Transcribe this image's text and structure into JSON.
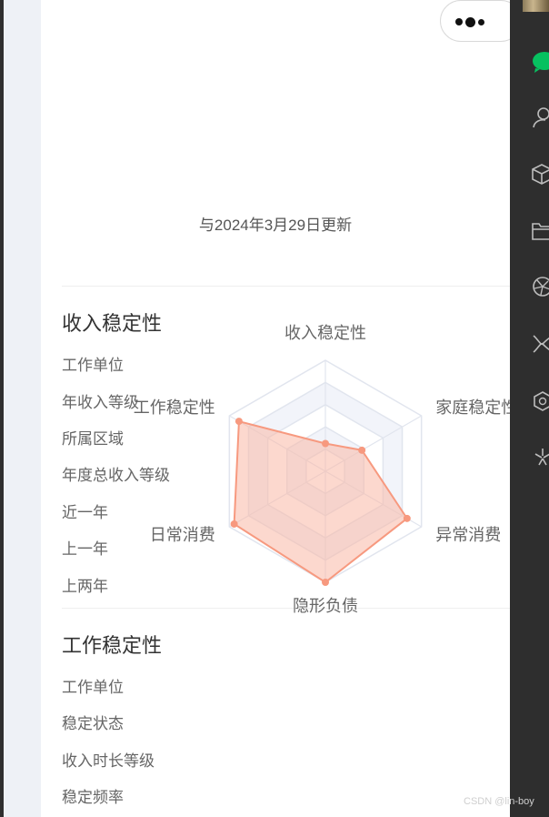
{
  "header": {
    "more_icon": "more-dots-icon",
    "update_text": "与2024年3月29日更新"
  },
  "income_section": {
    "title": "收入稳定性",
    "rows": [
      "工作单位",
      "年收入等级",
      "所属区域",
      "年度总收入等级",
      "近一年",
      "上一年",
      "上两年"
    ]
  },
  "chart_data": {
    "type": "radar",
    "indicators": [
      "收入稳定性",
      "家庭稳定性",
      "异常消费",
      "隐形负债",
      "日常消费",
      "工作稳定性"
    ],
    "max": 100,
    "series": [
      {
        "values": [
          25,
          38,
          85,
          100,
          95,
          90
        ]
      }
    ],
    "colors": {
      "line": "#f7997f",
      "fill": "#f9b8a5",
      "grid": "#e1e5ee",
      "split_area": "#f2f4fa"
    }
  },
  "work_section": {
    "title": "工作稳定性",
    "rows": [
      "工作单位",
      "稳定状态",
      "收入时长等级",
      "稳定频率"
    ]
  },
  "sidebar": {
    "icons": [
      "chat-icon",
      "contacts-icon",
      "box-icon",
      "folder-icon",
      "moments-icon",
      "channels-icon",
      "miniprogram-icon",
      "search-icon"
    ],
    "active_color": "#07c160"
  },
  "watermark": "CSDN @lin-boy"
}
